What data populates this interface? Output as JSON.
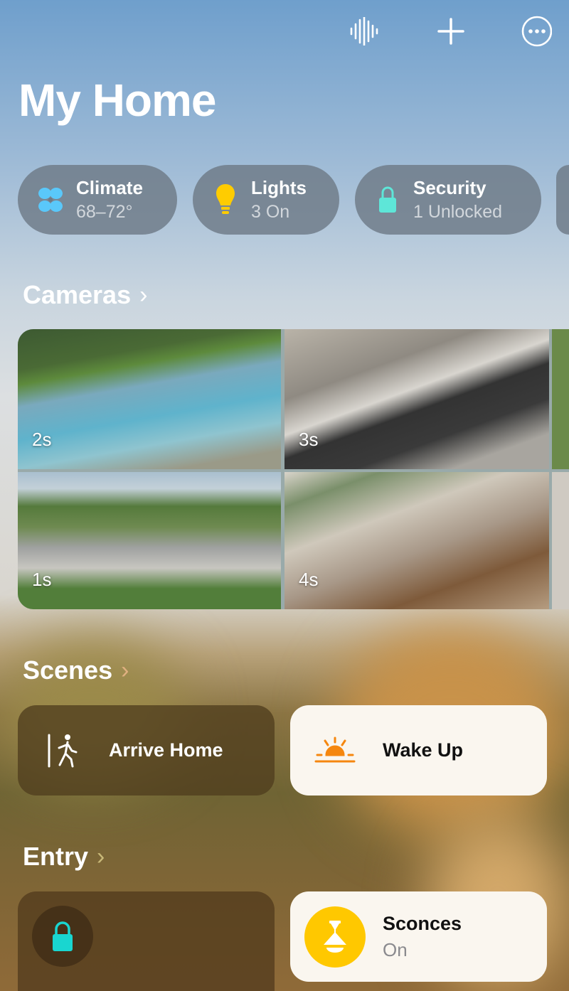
{
  "header": {
    "title": "My Home",
    "icons": [
      "waveform-icon",
      "plus-icon",
      "more-icon"
    ]
  },
  "status_pills": [
    {
      "title": "Climate",
      "subtitle": "68–72°",
      "icon": "fan-icon",
      "color": "#5ac8fa"
    },
    {
      "title": "Lights",
      "subtitle": "3 On",
      "icon": "lightbulb-icon",
      "color": "#ffcc00"
    },
    {
      "title": "Security",
      "subtitle": "1 Unlocked",
      "icon": "lock-open-icon",
      "color": "#5ee6d8"
    }
  ],
  "cameras": {
    "title": "Cameras",
    "items": [
      {
        "label": "2s"
      },
      {
        "label": "3s"
      },
      {
        "label": "1s"
      },
      {
        "label": "4s"
      }
    ]
  },
  "scenes": {
    "title": "Scenes",
    "items": [
      {
        "label": "Arrive Home",
        "icon": "arrive-home-icon"
      },
      {
        "label": "Wake Up",
        "icon": "sunrise-icon",
        "color": "#f5870f"
      }
    ]
  },
  "entry": {
    "title": "Entry",
    "accessories": [
      {
        "icon": "lock-icon",
        "color": "#19d6d0"
      },
      {
        "name": "Sconces",
        "status": "On",
        "icon": "pendant-lamp-icon",
        "color": "#ffc800"
      }
    ]
  }
}
